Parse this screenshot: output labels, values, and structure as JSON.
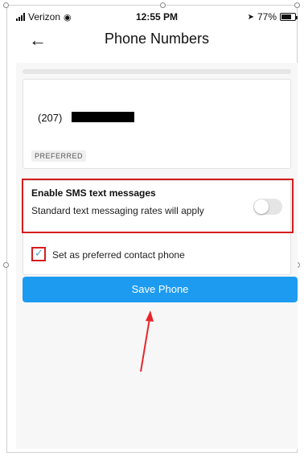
{
  "status_bar": {
    "carrier": "Verizon",
    "time": "12:55 PM",
    "battery_text": "77%",
    "battery_level": 0.77
  },
  "header": {
    "title": "Phone Numbers",
    "back_icon": "arrow-left-icon"
  },
  "phone_card": {
    "area_code": "(207)",
    "badge": "PREFERRED"
  },
  "sms": {
    "title": "Enable SMS text messages",
    "subtitle": "Standard text messaging rates will apply",
    "enabled": false
  },
  "preferred_contact": {
    "label": "Set as preferred contact phone",
    "checked": true
  },
  "save_button": {
    "label": "Save Phone"
  },
  "colors": {
    "accent": "#1d9bf0",
    "highlight": "#d41d1d"
  }
}
